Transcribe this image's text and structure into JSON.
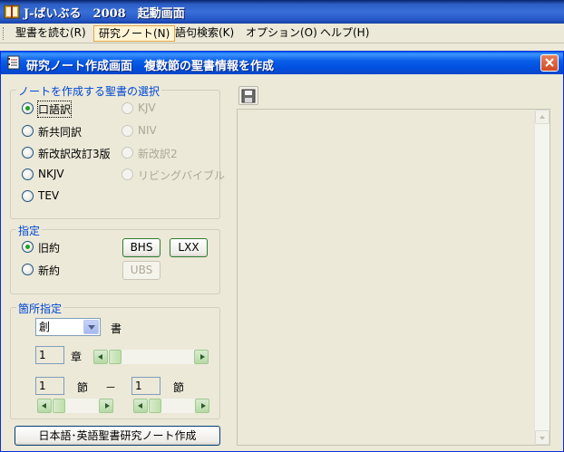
{
  "app": {
    "title": "J-ばいぶる　2008　起動画面"
  },
  "menubar": {
    "items": [
      {
        "label": "聖書を読む(R)"
      },
      {
        "label": "研究ノート(N)"
      },
      {
        "label": "語句検索(K)"
      },
      {
        "label": "オプション(O)"
      },
      {
        "label": "ヘルプ(H)"
      }
    ]
  },
  "child_window": {
    "title": "研究ノート作成画面　複数節の聖書情報を作成"
  },
  "bible_selection": {
    "legend": "ノートを作成する聖書の選択",
    "left_options": [
      "口語訳",
      "新共同訳",
      "新改訳改訂3版",
      "NKJV",
      "TEV"
    ],
    "right_options": [
      "KJV",
      "NIV",
      "新改訳2",
      "リビングバイブル"
    ],
    "selected": "口語訳"
  },
  "testament": {
    "legend": "指定",
    "options": [
      "旧約",
      "新約"
    ],
    "selected": "旧約",
    "buttons": [
      "BHS",
      "LXX",
      "UBS"
    ]
  },
  "passage": {
    "legend": "箇所指定",
    "book_value": "創",
    "book_suffix": "書",
    "chapter_value": "1",
    "chapter_suffix": "章",
    "verse_from": "1",
    "verse_to": "1",
    "verse_suffix": "節",
    "dash": "－"
  },
  "create_button": "日本語･英語聖書研究ノート作成",
  "icons": {
    "app": "app-book-icon",
    "child": "notebook-icon",
    "close": "close-icon",
    "save": "save-icon"
  },
  "colors": {
    "title_bar": "#0a246a",
    "child_title_bar": "#0058ee",
    "group_legend": "#0046d5",
    "close_button": "#d24a23"
  }
}
